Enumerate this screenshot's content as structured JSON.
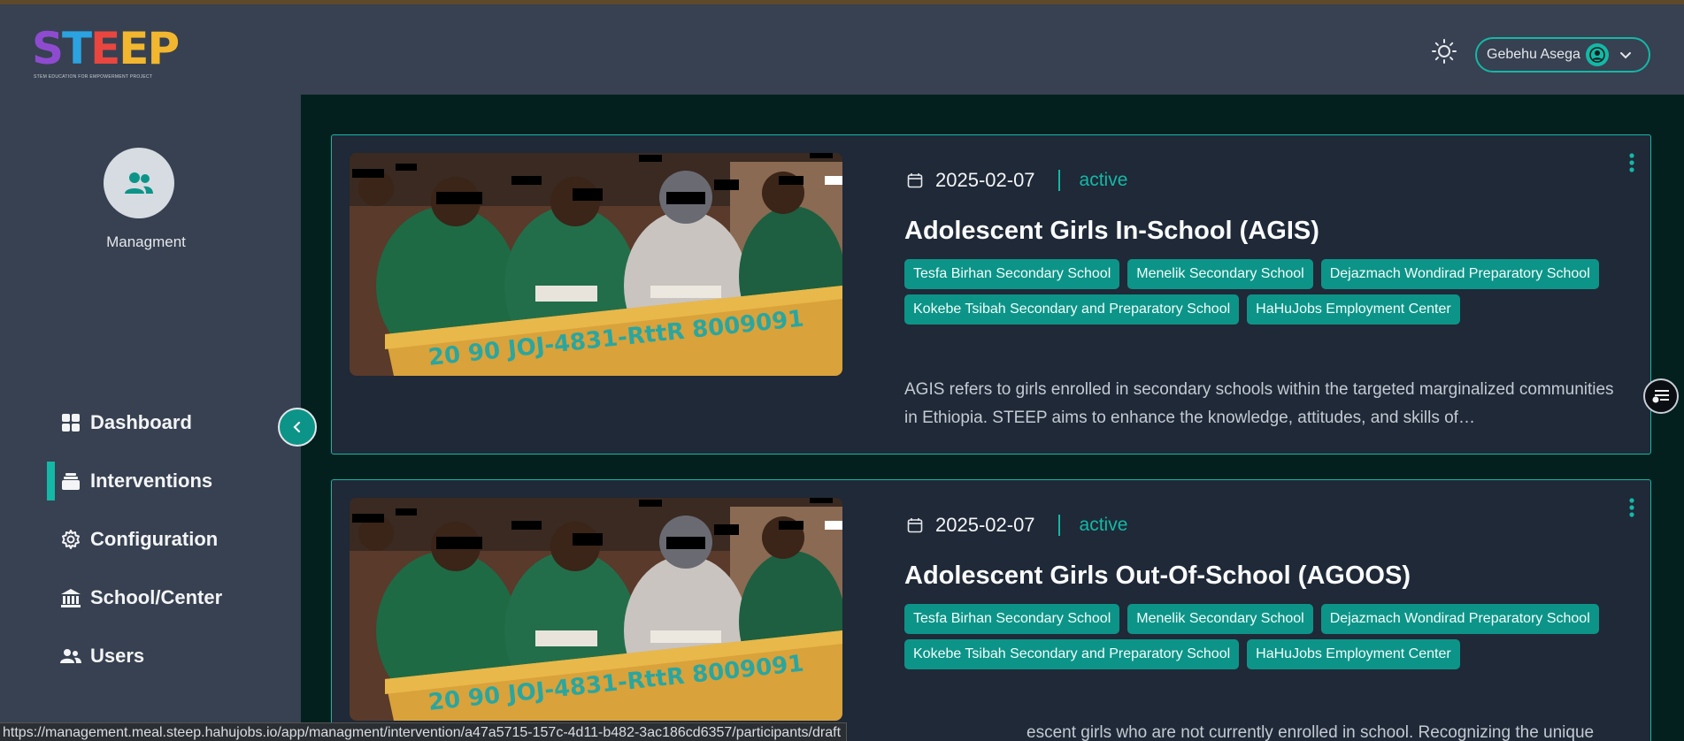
{
  "logo": {
    "letters": [
      "S",
      "T",
      "E",
      "E",
      "P"
    ],
    "subtitle": "STEM EDUCATION FOR EMPOWERMENT PROJECT"
  },
  "header": {
    "user_name": "Gebehu Asega",
    "theme_icon": "sun-icon"
  },
  "sidebar": {
    "section_label": "Managment",
    "items": [
      {
        "label": "Dashboard",
        "icon": "grid-icon",
        "active": false
      },
      {
        "label": "Interventions",
        "icon": "stack-icon",
        "active": true
      },
      {
        "label": "Configuration",
        "icon": "gear-icon",
        "active": false
      },
      {
        "label": "School/Center",
        "icon": "school-icon",
        "active": false
      },
      {
        "label": "Users",
        "icon": "users-icon",
        "active": false
      }
    ]
  },
  "interventions": [
    {
      "date": "2025-02-07",
      "status": "active",
      "title": "Adolescent Girls In-School (AGIS)",
      "tags": [
        "Tesfa Birhan Secondary School",
        "Menelik Secondary School",
        "Dejazmach Wondirad Preparatory School",
        "Kokebe Tsibah Secondary and Preparatory School",
        "HaHuJobs Employment Center"
      ],
      "description": "AGIS refers to girls enrolled in secondary schools within the targeted marginalized communities in Ethiopia. STEEP aims to enhance the knowledge, attitudes, and skills of…"
    },
    {
      "date": "2025-02-07",
      "status": "active",
      "title": "Adolescent Girls Out-Of-School (AGOOS)",
      "tags": [
        "Tesfa Birhan Secondary School",
        "Menelik Secondary School",
        "Dejazmach Wondirad Preparatory School",
        "Kokebe Tsibah Secondary and Preparatory School",
        "HaHuJobs Employment Center"
      ],
      "description": "escent girls who are not currently enrolled in school. Recognizing the unique"
    }
  ],
  "status_bar": {
    "url": "https://management.meal.steep.hahujobs.io/app/managment/intervention/a47a5715-157c-4d11-b482-3ac186cd6357/participants/draft"
  },
  "colors": {
    "accent": "#14b8a6",
    "sidebar": "#374151",
    "card": "#1f2937",
    "page_bg": "#03201e"
  }
}
